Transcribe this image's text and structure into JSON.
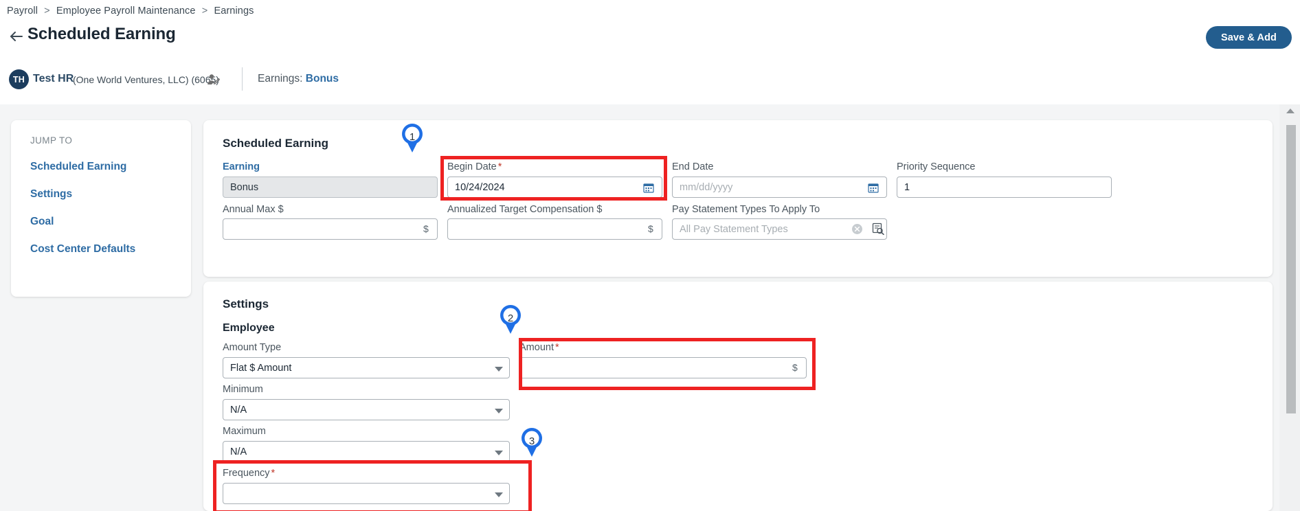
{
  "breadcrumb": {
    "items": [
      "Payroll",
      "Employee Payroll Maintenance",
      "Earnings"
    ],
    "separator": ">"
  },
  "header": {
    "title": "Scheduled Earning",
    "back_icon": "arrow-left-icon",
    "save_label": "Save & Add"
  },
  "employee": {
    "initials": "TH",
    "name": "Test HR",
    "org": "(One World Ventures, LLC) (6065)",
    "edit_icon": "person-edit-icon",
    "context_prefix": "Earnings:",
    "context_value": "Bonus"
  },
  "sidebar": {
    "heading": "JUMP TO",
    "items": [
      {
        "label": "Scheduled Earning"
      },
      {
        "label": "Settings"
      },
      {
        "label": "Goal"
      },
      {
        "label": "Cost Center Defaults"
      }
    ]
  },
  "scheduled_earning": {
    "section_title": "Scheduled Earning",
    "earning_label": "Earning",
    "earning_value": "Bonus",
    "begin_date_label": "Begin Date",
    "begin_date_value": "10/24/2024",
    "end_date_label": "End Date",
    "end_date_placeholder": "mm/dd/yyyy",
    "priority_label": "Priority Sequence",
    "priority_value": "1",
    "annual_max_label": "Annual Max $",
    "annual_max_value": "",
    "annual_max_suffix": "$",
    "annualized_target_label": "Annualized Target Compensation $",
    "annualized_target_value": "",
    "annualized_target_suffix": "$",
    "pay_statement_label": "Pay Statement Types To Apply To",
    "pay_statement_placeholder": "All Pay Statement Types",
    "calendar_icon": "calendar-icon",
    "clear_icon": "clear-circle-icon",
    "lookup_icon": "lookup-icon"
  },
  "settings": {
    "section_title": "Settings",
    "subsection_title": "Employee",
    "amount_type_label": "Amount Type",
    "amount_type_value": "Flat $ Amount",
    "amount_label": "Amount",
    "amount_value": "",
    "amount_suffix": "$",
    "minimum_label": "Minimum",
    "minimum_value": "N/A",
    "maximum_label": "Maximum",
    "maximum_value": "N/A",
    "frequency_label": "Frequency",
    "frequency_value": "",
    "required_marker": "*"
  },
  "callouts": [
    {
      "number": "1"
    },
    {
      "number": "2"
    },
    {
      "number": "3"
    }
  ],
  "colors": {
    "accent_blue": "#2e6ca4",
    "button_blue": "#235d8e",
    "highlight_red": "#ee2222",
    "pin_blue": "#1f6fe5",
    "required_red": "#c0392b"
  }
}
